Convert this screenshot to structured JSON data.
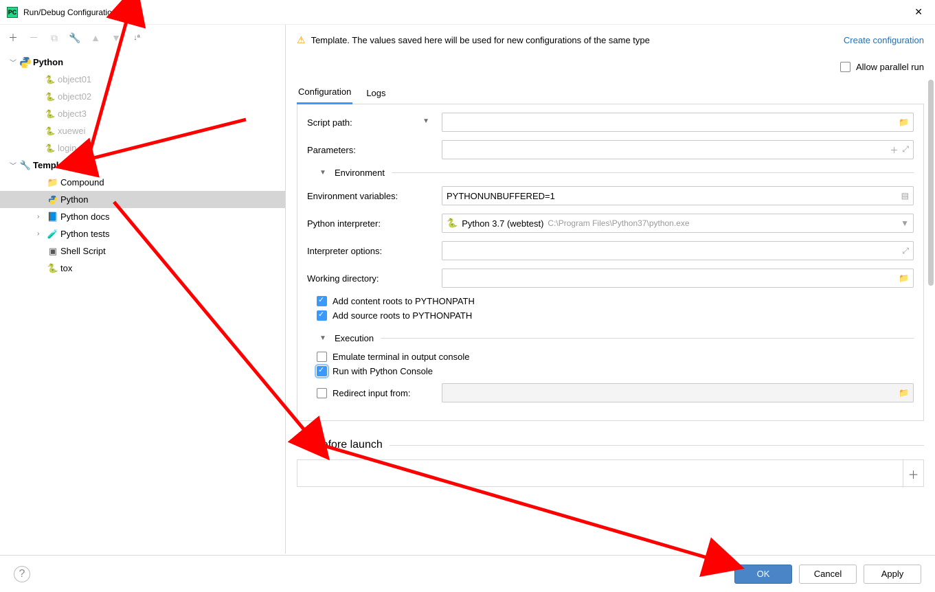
{
  "window": {
    "title": "Run/Debug Configurations"
  },
  "toolbar": {},
  "tree": {
    "python_group": "Python",
    "items": [
      "object01",
      "object02",
      "object3",
      "xuewei",
      "login"
    ],
    "templates_group": "Templates",
    "templates": {
      "compound": "Compound",
      "python": "Python",
      "python_docs": "Python docs",
      "python_tests": "Python tests",
      "shell_script": "Shell Script",
      "tox": "tox"
    }
  },
  "banner": {
    "text": "Template. The values saved here will be used for new configurations of the same type",
    "link": "Create configuration"
  },
  "allow_parallel": "Allow parallel run",
  "tabs": {
    "configuration": "Configuration",
    "logs": "Logs"
  },
  "form": {
    "script_path": "Script path:",
    "parameters": "Parameters:",
    "environment": "Environment",
    "env_vars_label": "Environment variables:",
    "env_vars_value": "PYTHONUNBUFFERED=1",
    "interpreter_label": "Python interpreter:",
    "interpreter_value": "Python 3.7 (webtest)",
    "interpreter_path": "C:\\Program Files\\Python37\\python.exe",
    "interp_options": "Interpreter options:",
    "working_dir": "Working directory:",
    "add_content_roots": "Add content roots to PYTHONPATH",
    "add_source_roots": "Add source roots to PYTHONPATH",
    "execution": "Execution",
    "emulate_terminal": "Emulate terminal in output console",
    "run_console": "Run with Python Console",
    "redirect_input": "Redirect input from:",
    "before_launch": "Before launch"
  },
  "footer": {
    "ok": "OK",
    "cancel": "Cancel",
    "apply": "Apply"
  }
}
